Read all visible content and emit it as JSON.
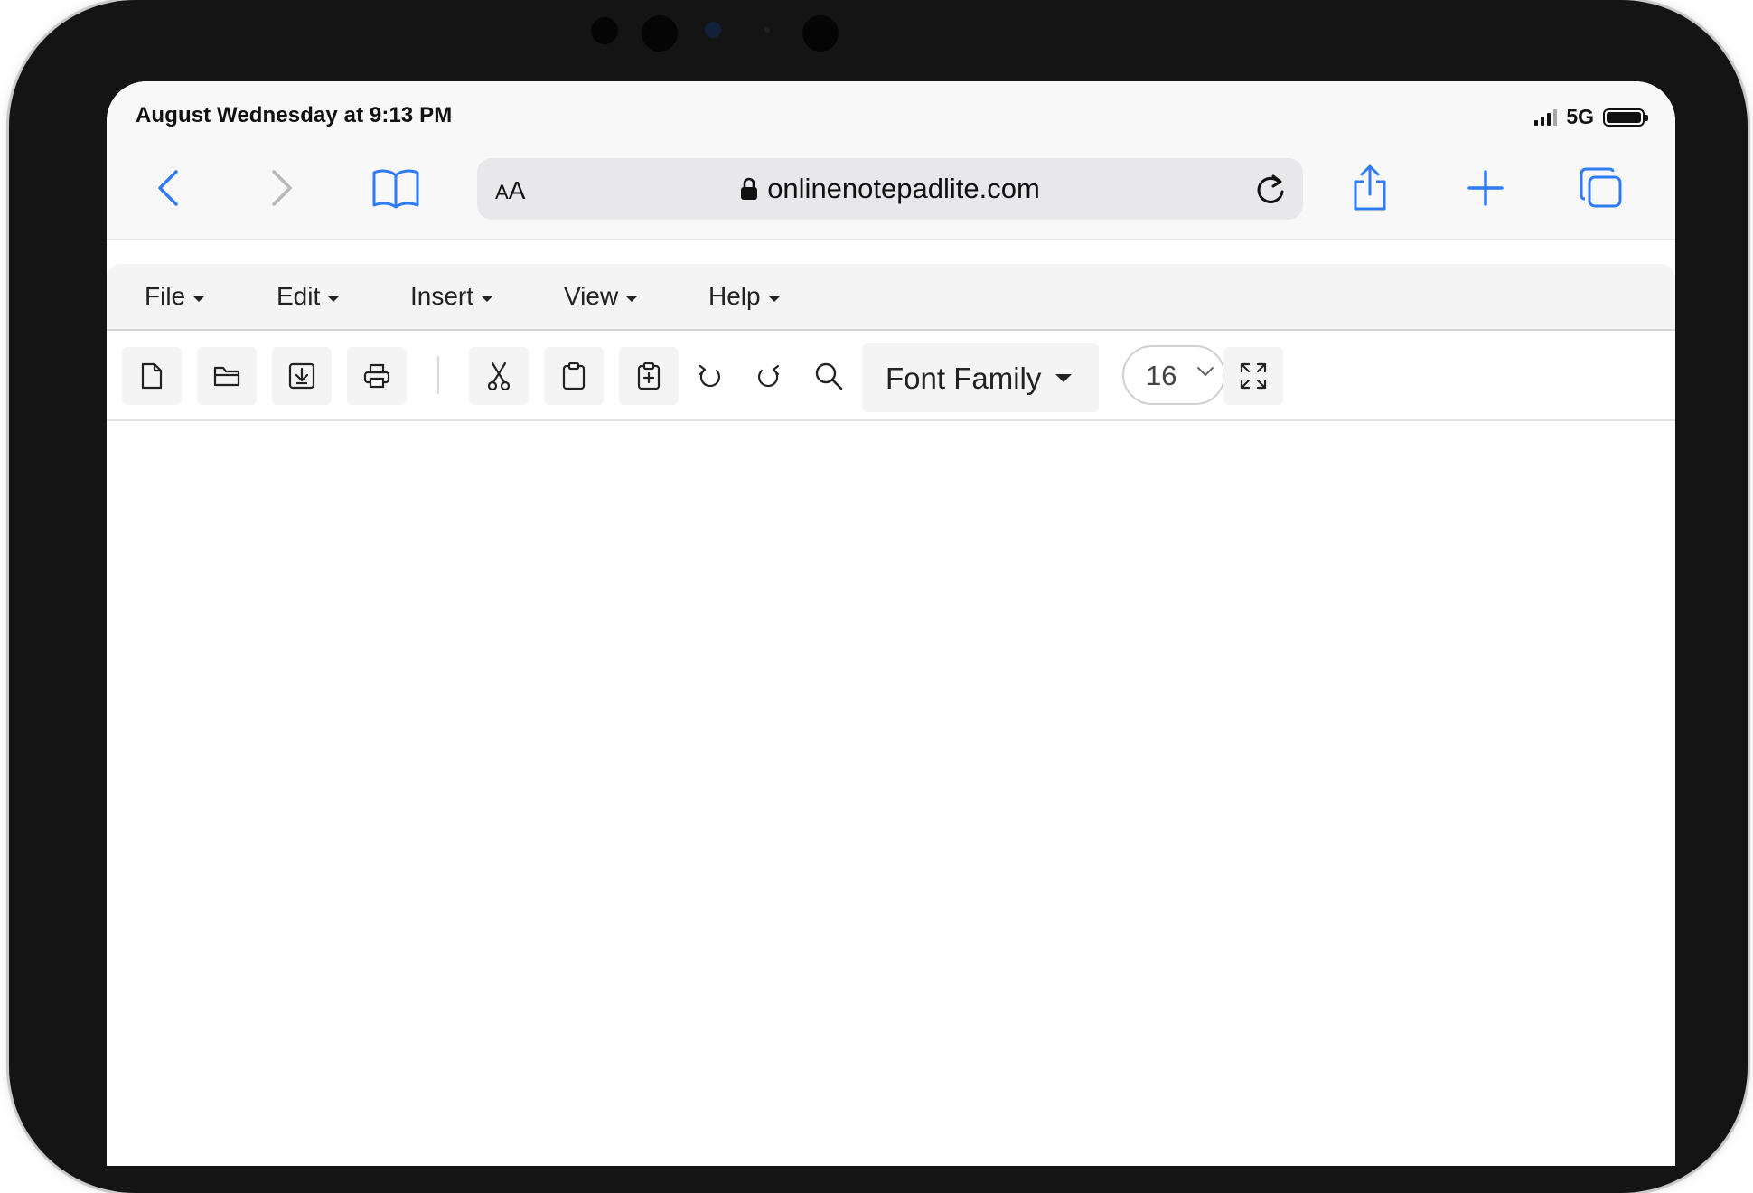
{
  "status_bar": {
    "datetime": "August Wednesday at 9:13 PM",
    "network": "5G",
    "battery_level": 1.0
  },
  "browser": {
    "text_size_label": "AA",
    "url": "onlinenotepadlite.com",
    "accent_color": "#2f7bf6"
  },
  "menu": {
    "items": [
      "File",
      "Edit",
      "Insert",
      "View",
      "Help"
    ]
  },
  "toolbar": {
    "font_family_label": "Font Family",
    "font_size_value": "16"
  },
  "editor": {
    "content": ""
  }
}
